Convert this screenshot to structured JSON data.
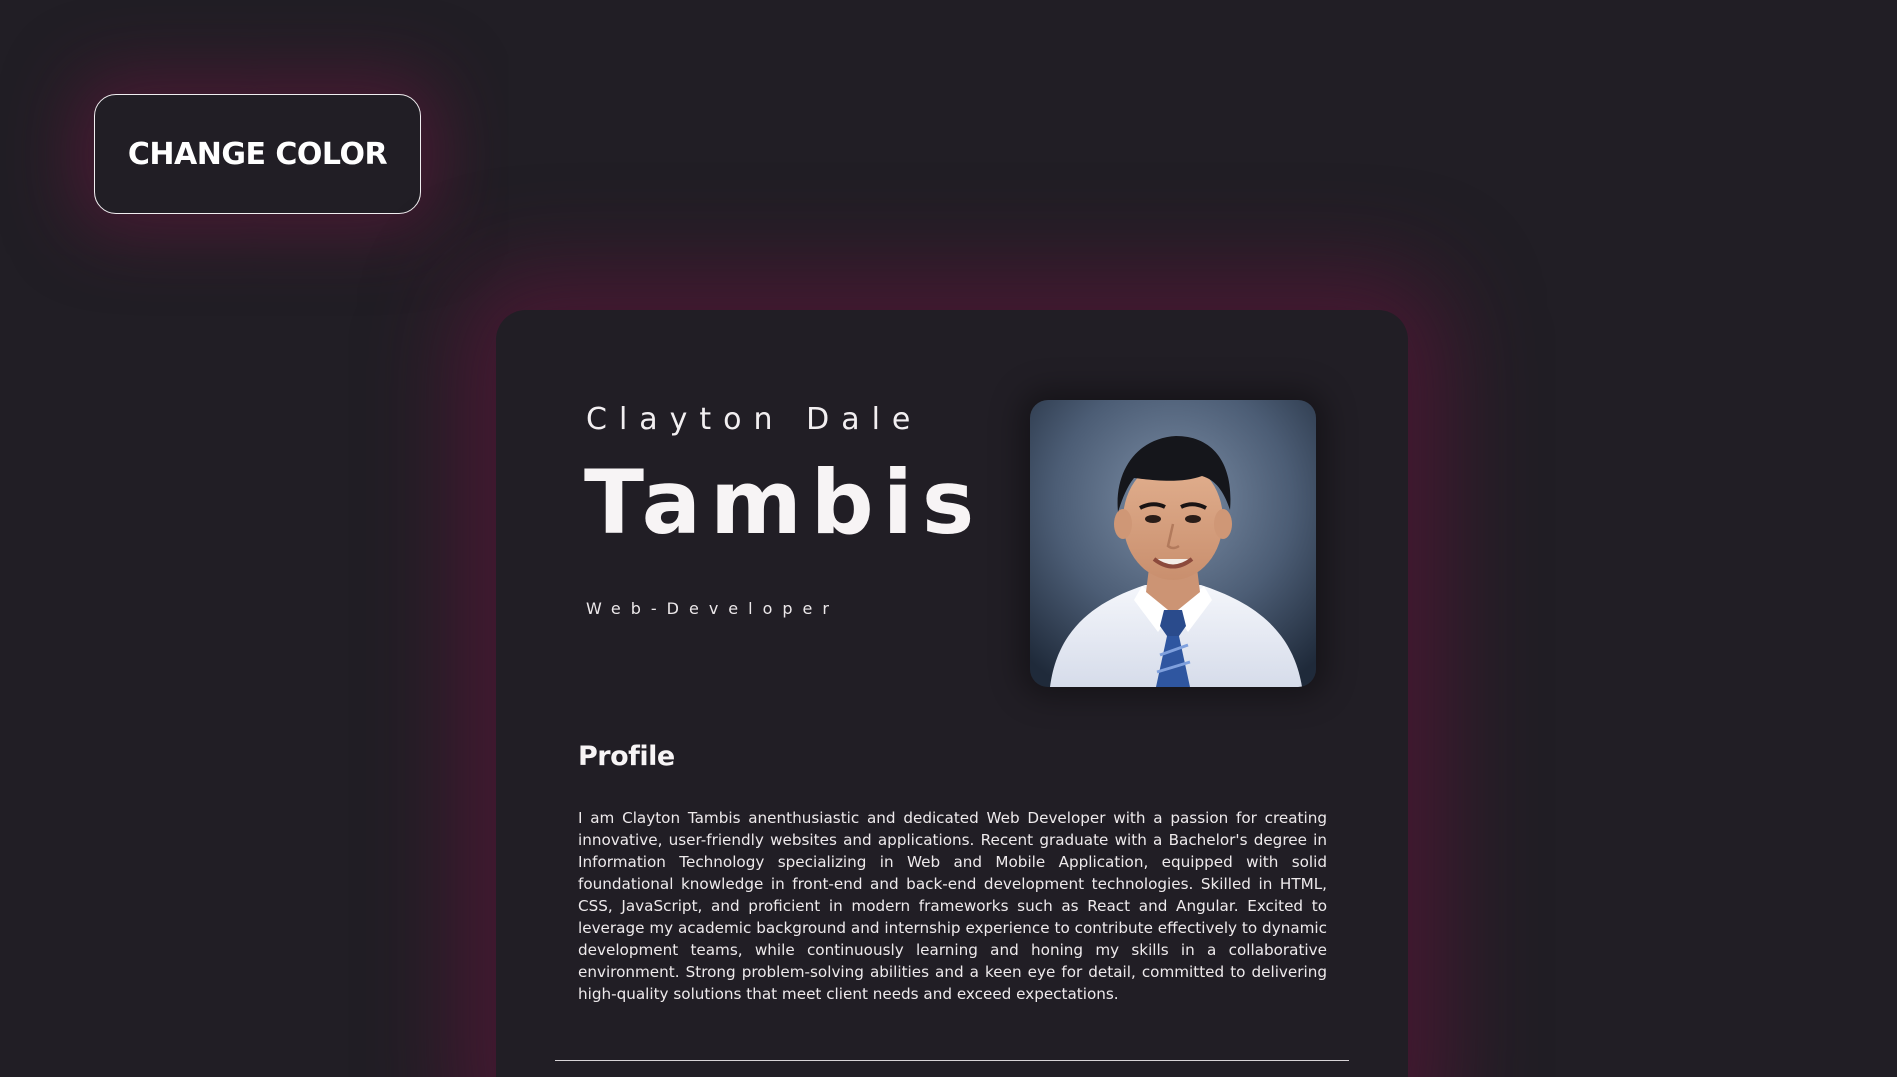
{
  "controls": {
    "change_color_label": "CHANGE COLOR"
  },
  "resume": {
    "first_name": "Clayton Dale",
    "last_name": "Tambis",
    "role": "Web-Developer",
    "photo_alt": "portrait-photo",
    "profile_heading": "Profile",
    "profile_text": "I am Clayton Tambis anenthusiastic and dedicated Web Developer with a passion for creating innovative, user-friendly websites and applications. Recent graduate with a Bachelor's degree in Information Technology specializing in Web and Mobile Application, equipped with solid foundational knowledge in front-end and back-end development technologies. Skilled in HTML, CSS, JavaScript, and proficient in modern frameworks such as React and Angular. Excited to leverage my academic background and internship experience to contribute effectively to dynamic development teams, while continuously learning and honing my skills in a collaborative environment. Strong problem-solving abilities and a keen eye for detail, committed to delivering high-quality solutions that meet client needs and exceed expectations."
  },
  "colors": {
    "background": "#211e25",
    "glow": "#6a163e",
    "text": "#f5f2f3"
  }
}
